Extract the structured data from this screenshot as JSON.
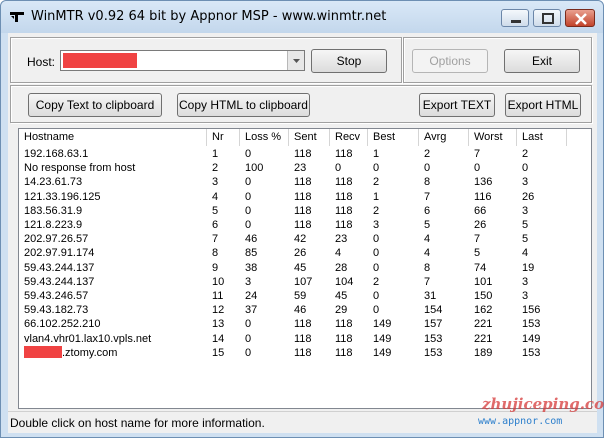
{
  "window": {
    "title": "WinMTR v0.92 64 bit by Appnor MSP - www.winmtr.net",
    "icon": "winmtr-app-icon"
  },
  "host": {
    "label": "Host:",
    "value_redacted": true
  },
  "buttons": {
    "stop": "Stop",
    "options": "Options",
    "exit": "Exit",
    "copy_text": "Copy Text to clipboard",
    "copy_html": "Copy HTML to clipboard",
    "export_text": "Export TEXT",
    "export_html": "Export HTML"
  },
  "table": {
    "columns": [
      "Hostname",
      "Nr",
      "Loss %",
      "Sent",
      "Recv",
      "Best",
      "Avrg",
      "Worst",
      "Last"
    ],
    "rows": [
      [
        "192.168.63.1",
        "1",
        "0",
        "118",
        "118",
        "1",
        "2",
        "7",
        "2"
      ],
      [
        "No response from host",
        "2",
        "100",
        "23",
        "0",
        "0",
        "0",
        "0",
        "0"
      ],
      [
        "14.23.61.73",
        "3",
        "0",
        "118",
        "118",
        "2",
        "8",
        "136",
        "3"
      ],
      [
        "121.33.196.125",
        "4",
        "0",
        "118",
        "118",
        "1",
        "7",
        "116",
        "26"
      ],
      [
        "183.56.31.9",
        "5",
        "0",
        "118",
        "118",
        "2",
        "6",
        "66",
        "3"
      ],
      [
        "121.8.223.9",
        "6",
        "0",
        "118",
        "118",
        "3",
        "5",
        "26",
        "5"
      ],
      [
        "202.97.26.57",
        "7",
        "46",
        "42",
        "23",
        "0",
        "4",
        "7",
        "5"
      ],
      [
        "202.97.91.174",
        "8",
        "85",
        "26",
        "4",
        "0",
        "4",
        "5",
        "4"
      ],
      [
        "59.43.244.137",
        "9",
        "38",
        "45",
        "28",
        "0",
        "8",
        "74",
        "19"
      ],
      [
        "59.43.244.137",
        "10",
        "3",
        "107",
        "104",
        "2",
        "7",
        "101",
        "3"
      ],
      [
        "59.43.246.57",
        "11",
        "24",
        "59",
        "45",
        "0",
        "31",
        "150",
        "3"
      ],
      [
        "59.43.182.73",
        "12",
        "37",
        "46",
        "29",
        "0",
        "154",
        "162",
        "156"
      ],
      [
        "66.102.252.210",
        "13",
        "0",
        "118",
        "118",
        "149",
        "157",
        "221",
        "153"
      ],
      [
        "vlan4.vhr01.lax10.vpls.net",
        "14",
        "0",
        "118",
        "118",
        "149",
        "153",
        "221",
        "149"
      ],
      [
        ".ztomy.com",
        "15",
        "0",
        "118",
        "118",
        "149",
        "153",
        "189",
        "153"
      ]
    ]
  },
  "status": "Double click on host name for more information.",
  "watermark": {
    "site": "zhujiceping.com",
    "url": "www.appnor.com"
  },
  "colors": {
    "redaction": "#f04343",
    "frame": "#cfe0f1"
  }
}
